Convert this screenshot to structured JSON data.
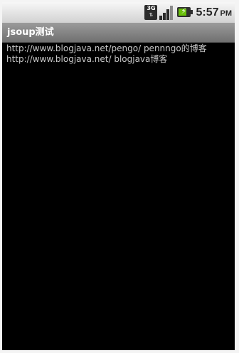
{
  "status_bar": {
    "network_label": "3G",
    "network_arrows": "⇅",
    "battery_bolt": "⚡",
    "time": "5:57",
    "ampm": "PM",
    "icons": [
      "network-3g-icon",
      "signal-icon",
      "battery-charging-icon"
    ]
  },
  "app": {
    "title": "jsoup测试"
  },
  "content": {
    "lines": [
      "http://www.blogjava.net/pengo/  pennngo的博客",
      "http://www.blogjava.net/  blogjava博客"
    ]
  },
  "colors": {
    "background": "#000000",
    "text": "#c8c8c8",
    "title_bar": "#858585",
    "status_bar": "#e6e6e6",
    "battery_fill": "#69c10a"
  }
}
